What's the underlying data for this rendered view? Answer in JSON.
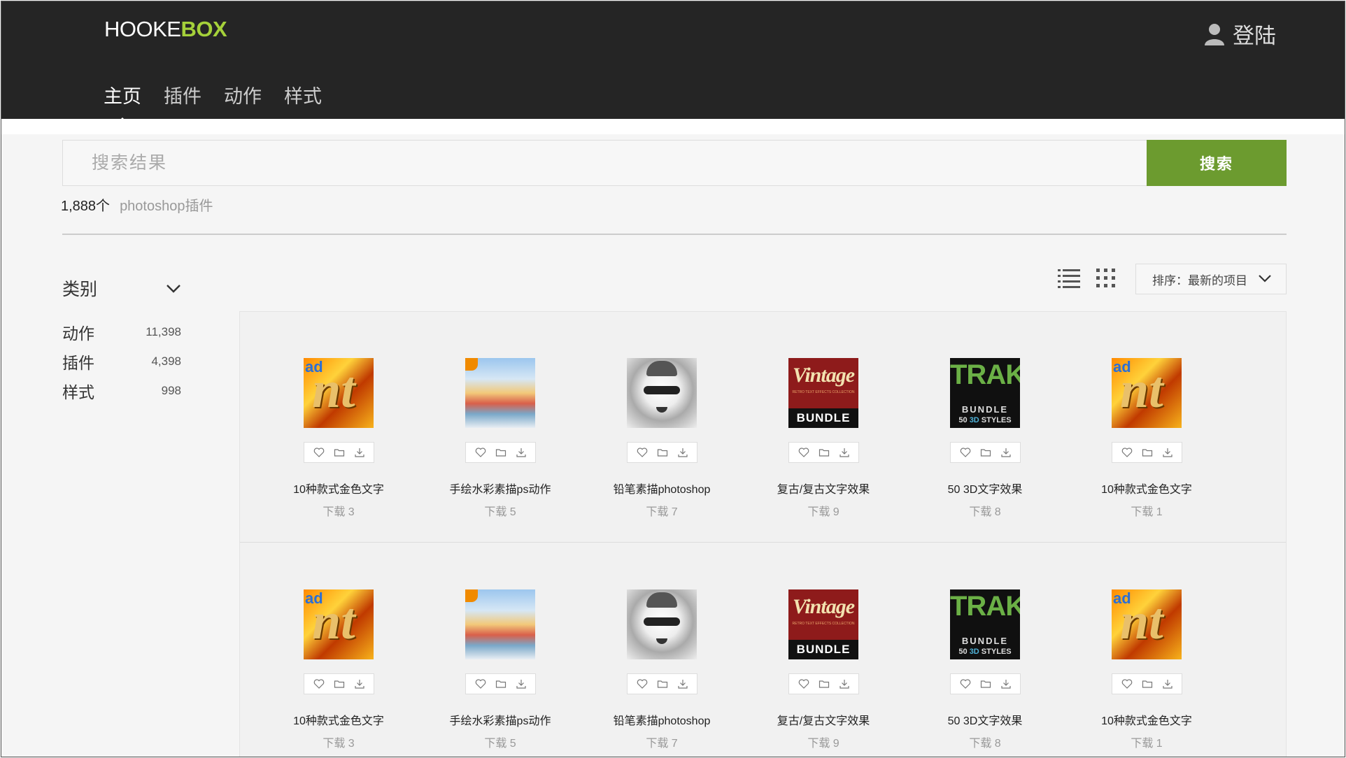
{
  "header": {
    "logo": {
      "part1": "HOOKE",
      "part2": "BOX"
    },
    "login_label": "登陆",
    "nav": [
      "主页",
      "插件",
      "动作",
      "样式"
    ]
  },
  "search": {
    "placeholder": "搜索结果",
    "button": "搜索",
    "result_count": "1,888个",
    "result_term": "photoshop插件"
  },
  "sidebar": {
    "title": "类别",
    "categories": [
      {
        "label": "动作",
        "count": "11,398"
      },
      {
        "label": "插件",
        "count": "4,398"
      },
      {
        "label": "样式",
        "count": "998"
      }
    ]
  },
  "toolbar": {
    "sort_label": "排序：最新的项目"
  },
  "thumb_text": {
    "gold_ad": "ad",
    "gold_nt": "nt",
    "vintage": "Vintage",
    "vintage_sub": "RETRO TEXT EFFECTS COLLECTION",
    "bundle": "BUNDLE",
    "trak": "TRAK",
    "trak_bundle": "BUNDLE",
    "trak_styles_pre": "50 ",
    "trak_styles_mid": "3D",
    "trak_styles_post": " STYLES"
  },
  "rows": [
    {
      "items": [
        {
          "title": "10种款式金色文字",
          "downloads": "下载 3"
        },
        {
          "title": "手绘水彩素描ps动作",
          "downloads": "下载 5"
        },
        {
          "title": "铅笔素描photoshop",
          "downloads": "下载 7"
        },
        {
          "title": "复古/复古文字效果",
          "downloads": "下载 9"
        },
        {
          "title": "50 3D文字效果",
          "downloads": "下载 8"
        },
        {
          "title": "10种款式金色文字",
          "downloads": "下载 1"
        }
      ]
    },
    {
      "items": [
        {
          "title": "10种款式金色文字",
          "downloads": "下载 3"
        },
        {
          "title": "手绘水彩素描ps动作",
          "downloads": "下载 5"
        },
        {
          "title": "铅笔素描photoshop",
          "downloads": "下载 7"
        },
        {
          "title": "复古/复古文字效果",
          "downloads": "下载 9"
        },
        {
          "title": "50 3D文字效果",
          "downloads": "下载 8"
        },
        {
          "title": "10种款式金色文字",
          "downloads": "下载 1"
        }
      ]
    }
  ],
  "colors": {
    "header_bg": "#252525",
    "logo_accent": "#a5d13a",
    "search_button": "#6c9b2f"
  }
}
